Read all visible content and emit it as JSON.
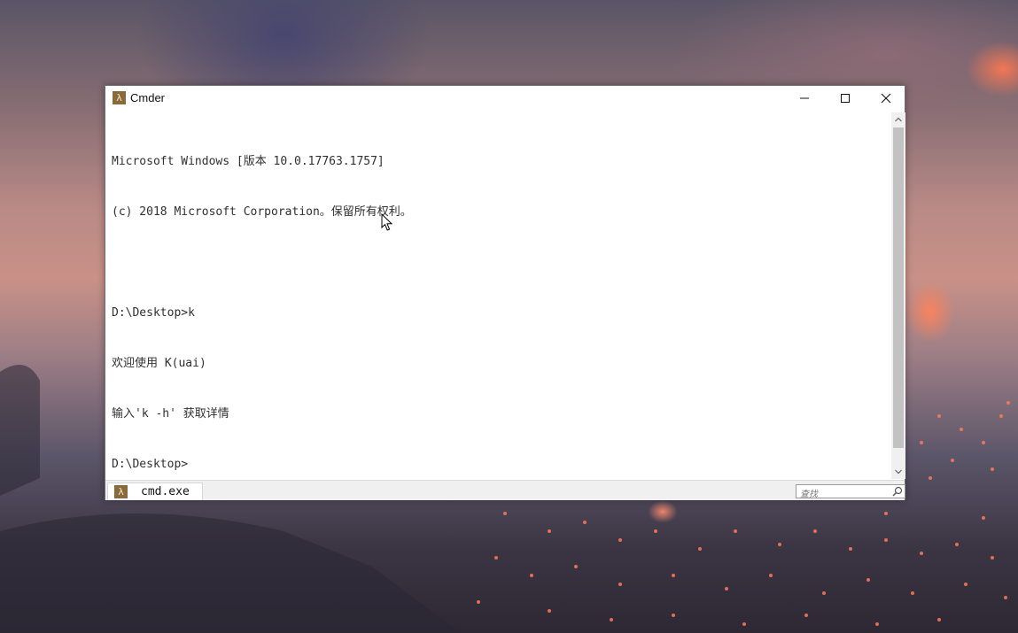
{
  "window": {
    "title": "Cmder",
    "app_icon_glyph": "λ",
    "controls": [
      "minimize-icon",
      "maximize-icon",
      "close-icon"
    ]
  },
  "console": {
    "lines": [
      "Microsoft Windows [版本 10.0.17763.1757]",
      "(c) 2018 Microsoft Corporation。保留所有权利。",
      "",
      "D:\\Desktop>k",
      "欢迎使用 K(uai)",
      "输入'k -h' 获取详情",
      "D:\\Desktop>"
    ]
  },
  "statusbar": {
    "tab_label": "cmd.exe",
    "tab_icon_glyph": "λ",
    "search_placeholder": "查找"
  },
  "colors": {
    "console_text": "#303030",
    "icon_bg": "#8a6a3a",
    "window_bg": "#ffffff"
  }
}
